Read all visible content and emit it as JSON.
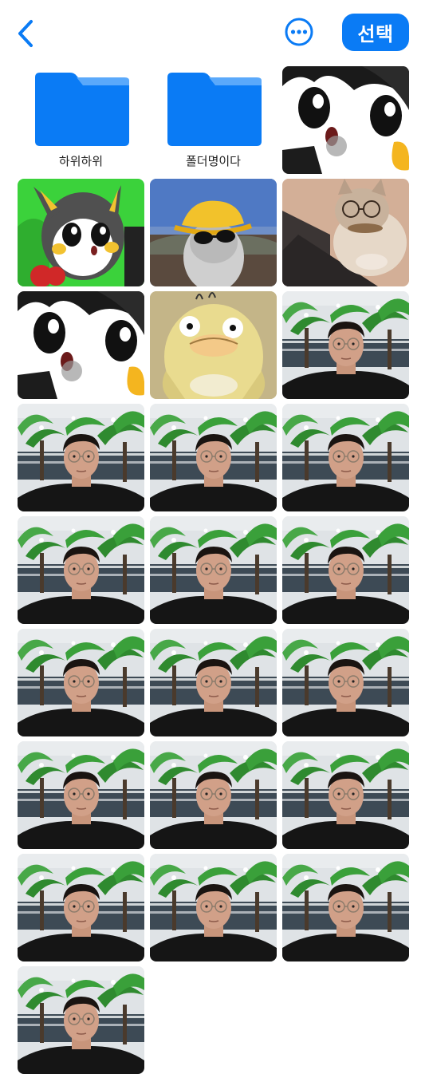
{
  "toolbar": {
    "back_icon": "chevron-left-icon",
    "more_icon": "ellipsis-circle-icon",
    "select_label": "선택",
    "accent_color": "#0a7bf5"
  },
  "folders": [
    {
      "label": "하위하위",
      "icon": "folder-icon",
      "color": "#0a7bf5"
    },
    {
      "label": "폴더명이다",
      "icon": "folder-icon",
      "color": "#0a7bf5"
    }
  ],
  "thumbnails": [
    {
      "kind": "emolga-closeup"
    },
    {
      "kind": "emolga-apple"
    },
    {
      "kind": "cat-hat"
    },
    {
      "kind": "cat-laptop"
    },
    {
      "kind": "emolga-closeup"
    },
    {
      "kind": "psyduck"
    },
    {
      "kind": "selfie"
    },
    {
      "kind": "selfie"
    },
    {
      "kind": "selfie"
    },
    {
      "kind": "selfie"
    },
    {
      "kind": "selfie"
    },
    {
      "kind": "selfie"
    },
    {
      "kind": "selfie"
    },
    {
      "kind": "selfie"
    },
    {
      "kind": "selfie"
    },
    {
      "kind": "selfie"
    },
    {
      "kind": "selfie"
    },
    {
      "kind": "selfie"
    },
    {
      "kind": "selfie"
    },
    {
      "kind": "selfie"
    },
    {
      "kind": "selfie"
    },
    {
      "kind": "selfie"
    },
    {
      "kind": "selfie"
    }
  ]
}
